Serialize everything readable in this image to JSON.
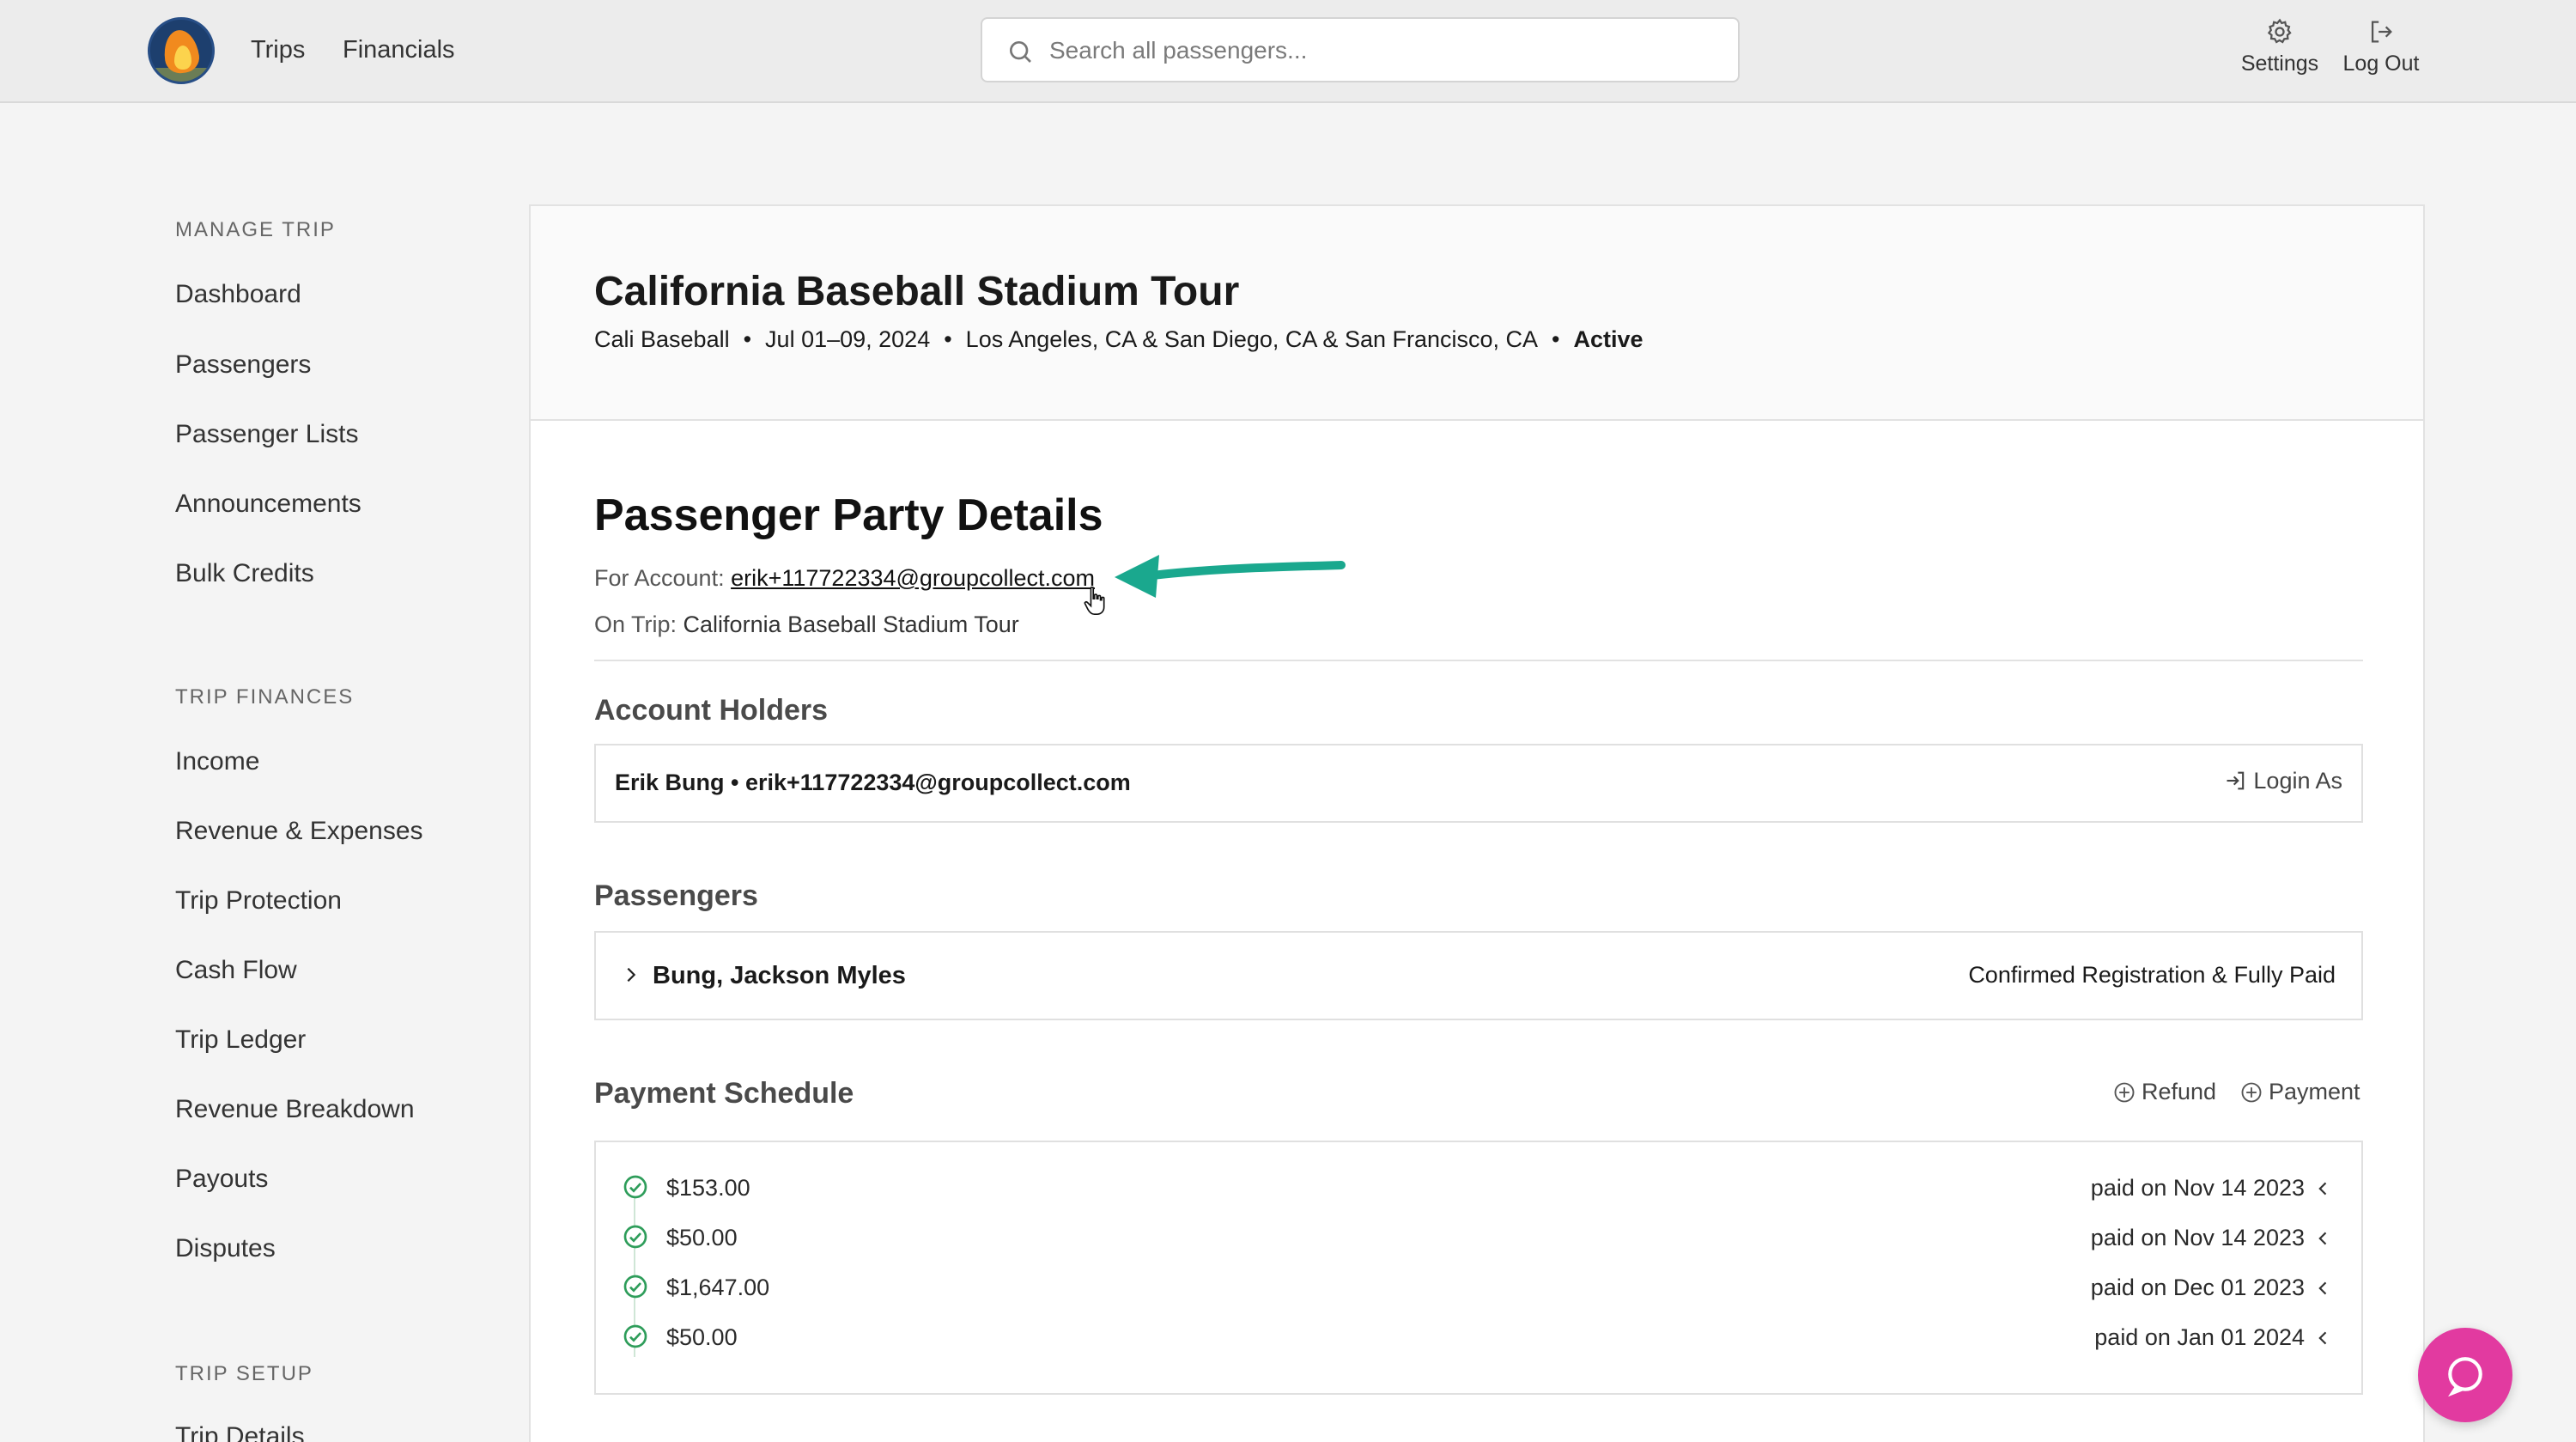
{
  "topbar": {
    "nav": [
      "Trips",
      "Financials"
    ],
    "search_placeholder": "Search all passengers...",
    "settings_label": "Settings",
    "logout_label": "Log Out"
  },
  "sidebar": {
    "manage_heading": "MANAGE TRIP",
    "manage_items": [
      "Dashboard",
      "Passengers",
      "Passenger Lists",
      "Announcements",
      "Bulk Credits"
    ],
    "finance_heading": "TRIP FINANCES",
    "finance_items": [
      "Income",
      "Revenue & Expenses",
      "Trip Protection",
      "Cash Flow",
      "Trip Ledger",
      "Revenue Breakdown",
      "Payouts",
      "Disputes"
    ],
    "setup_heading": "TRIP SETUP",
    "setup_items": [
      "Trip Details"
    ]
  },
  "trip": {
    "title": "California Baseball Stadium Tour",
    "group": "Cali Baseball",
    "dates": "Jul 01–09, 2024",
    "locations": "Los Angeles, CA & San Diego, CA & San Francisco, CA",
    "status": "Active"
  },
  "party": {
    "title": "Passenger Party Details",
    "account_label": "For Account:",
    "account_email": "erik+117722334@groupcollect.com",
    "trip_label": "On Trip:",
    "trip_name": "California Baseball Stadium Tour"
  },
  "holders": {
    "title": "Account Holders",
    "holder": "Erik Bung • erik+117722334@groupcollect.com",
    "login_as": "Login As"
  },
  "passengers": {
    "title": "Passengers",
    "items": [
      {
        "name": "Bung, Jackson Myles",
        "status": "Confirmed Registration & Fully Paid"
      }
    ]
  },
  "payment": {
    "title": "Payment Schedule",
    "refund_label": "Refund",
    "payment_label": "Payment",
    "rows": [
      {
        "amount": "$153.00",
        "status": "paid on Nov 14 2023"
      },
      {
        "amount": "$50.00",
        "status": "paid on Nov 14 2023"
      },
      {
        "amount": "$1,647.00",
        "status": "paid on Dec 01 2023"
      },
      {
        "amount": "$50.00",
        "status": "paid on Jan 01 2024"
      }
    ]
  },
  "colors": {
    "accent_green": "#1aa88e",
    "check_green": "#2e9d5a",
    "help_pink": "#e23aa0"
  }
}
